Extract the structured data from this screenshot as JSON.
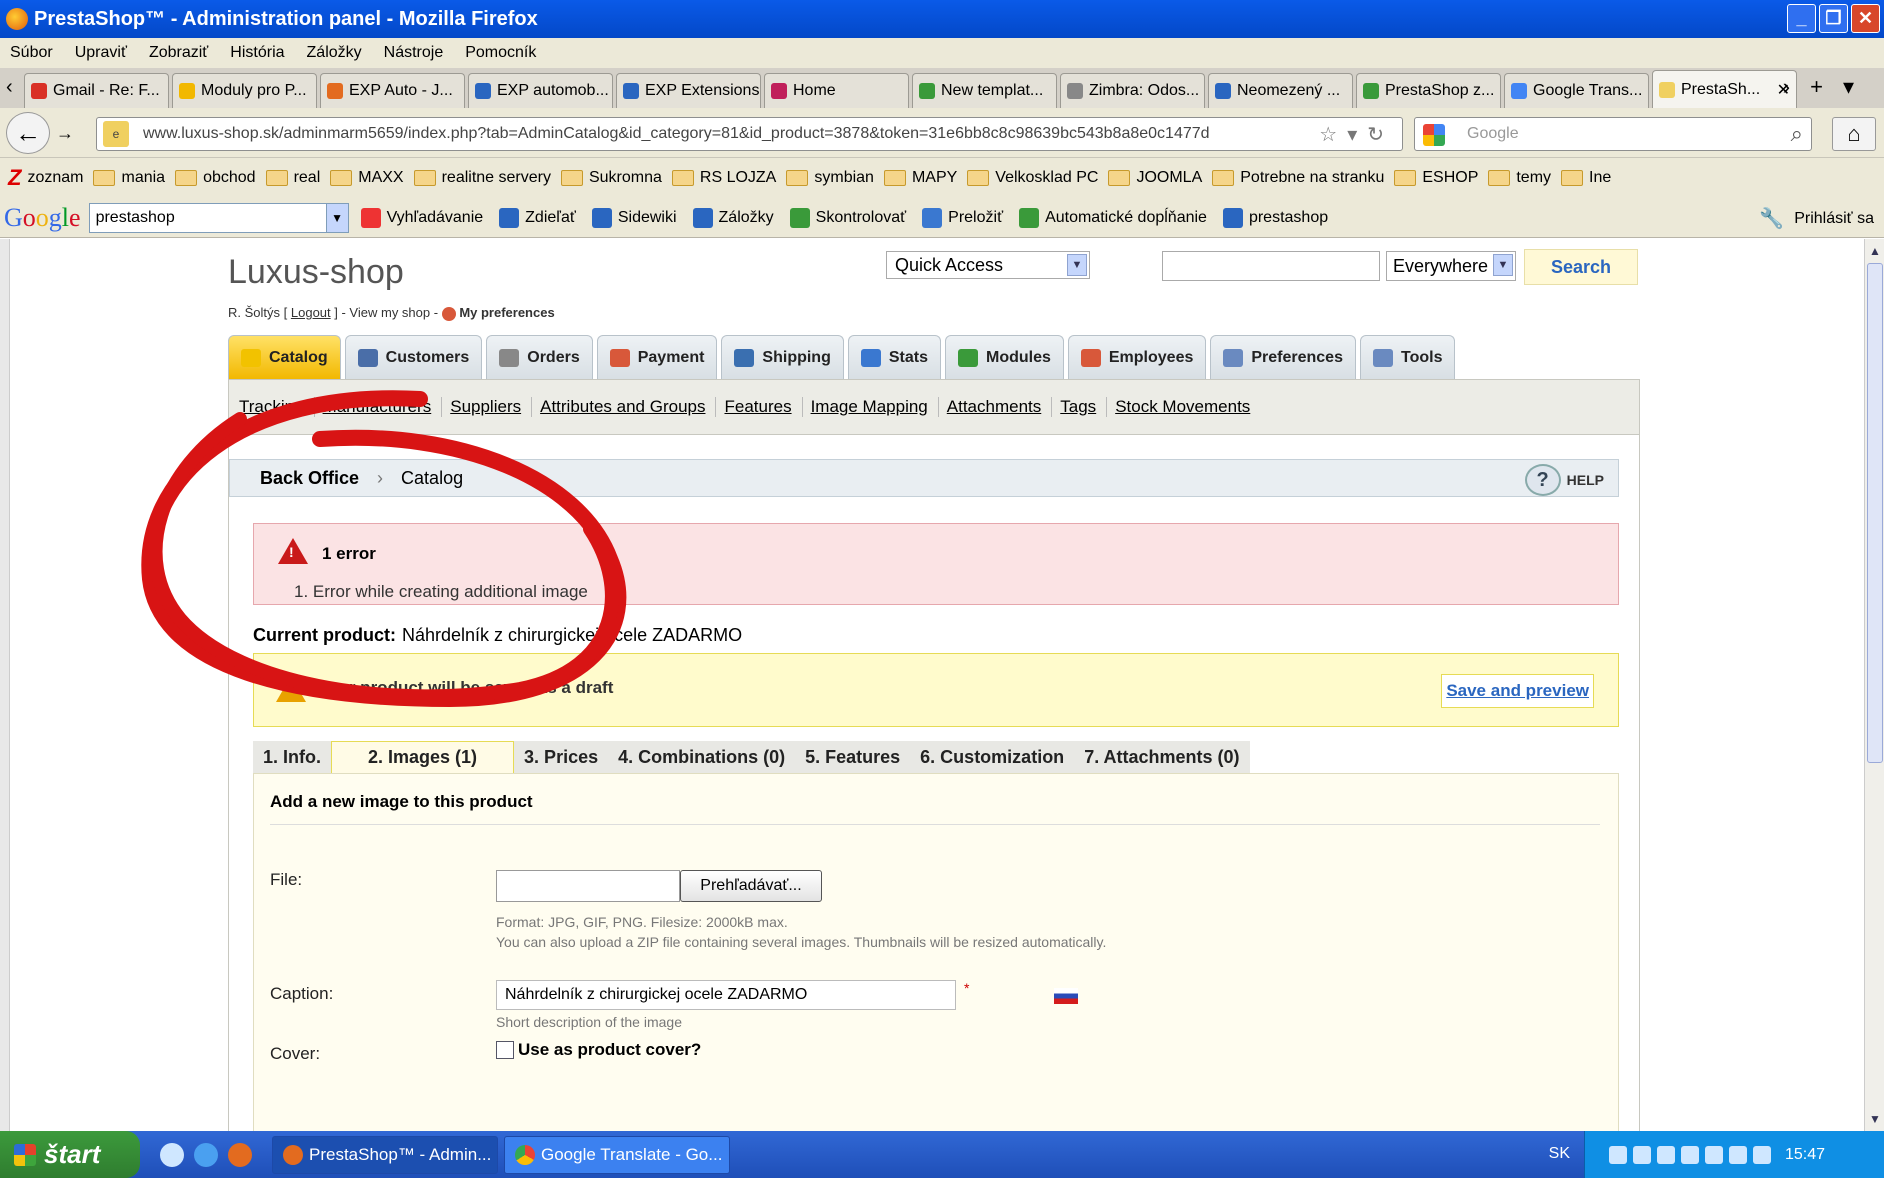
{
  "window": {
    "title": "PrestaShop™ - Administration panel - Mozilla Firefox"
  },
  "menu": [
    "Súbor",
    "Upraviť",
    "Zobraziť",
    "História",
    "Záložky",
    "Nástroje",
    "Pomocník"
  ],
  "tabs": [
    {
      "label": "Gmail - Re: F...",
      "color": "#d93025"
    },
    {
      "label": "Moduly pro P...",
      "color": "#f2b800"
    },
    {
      "label": "EXP Auto - J...",
      "color": "#e36b1f"
    },
    {
      "label": "EXP automob...",
      "color": "#2a66c0"
    },
    {
      "label": "EXP Extensions",
      "color": "#2a66c0"
    },
    {
      "label": "Home",
      "color": "#c01f5a"
    },
    {
      "label": "New templat...",
      "color": "#3a9a3a"
    },
    {
      "label": "Zimbra: Odos...",
      "color": "#888888"
    },
    {
      "label": "Neomezený ...",
      "color": "#2a66c0"
    },
    {
      "label": "PrestaShop z...",
      "color": "#3a9a3a"
    },
    {
      "label": "Google Trans...",
      "color": "#4285f4"
    },
    {
      "label": "PrestaSh...",
      "color": "#f0d060",
      "active": true
    }
  ],
  "nav": {
    "url": "www.luxus-shop.sk/adminmarm5659/index.php?tab=AdminCatalog&id_category=81&id_product=3878&token=31e6bb8c8c98639bc543b8a8e0c1477d",
    "search_placeholder": "Google"
  },
  "bookmarks": [
    "zoznam",
    "mania",
    "obchod",
    "real",
    "MAXX",
    "realitne servery",
    "Sukromna",
    "RS LOJZA",
    "symbian",
    "MAPY",
    "Velkosklad PC",
    "JOOMLA",
    "Potrebne na stranku",
    "ESHOP",
    "temy",
    "Ine"
  ],
  "google_toolbar": {
    "logo": [
      "G",
      "o",
      "o",
      "g",
      "l",
      "e"
    ],
    "query": "prestashop",
    "items": [
      "Vyhľadávanie",
      "Zdieľať",
      "Sidewiki",
      "Záložky",
      "Skontrolovať",
      "Preložiť",
      "Automatické dopĺňanie",
      "prestashop"
    ],
    "signin": "Prihlásiť sa"
  },
  "shop": {
    "name": "Luxus-shop",
    "user": "R. Šoltýs [",
    "logout": "Logout",
    "user_rest": "] - View my shop -",
    "prefs": "My preferences",
    "quick_access": "Quick Access",
    "everywhere": "Everywhere",
    "search_btn": "Search"
  },
  "main_tabs": [
    {
      "label": "Catalog",
      "color": "#f2c200",
      "active": true
    },
    {
      "label": "Customers",
      "color": "#4a6ea8"
    },
    {
      "label": "Orders",
      "color": "#888888"
    },
    {
      "label": "Payment",
      "color": "#d8583a"
    },
    {
      "label": "Shipping",
      "color": "#3a6fb0"
    },
    {
      "label": "Stats",
      "color": "#3a78d0"
    },
    {
      "label": "Modules",
      "color": "#3a9a3a"
    },
    {
      "label": "Employees",
      "color": "#d8583a"
    },
    {
      "label": "Preferences",
      "color": "#6a8ac0"
    },
    {
      "label": "Tools",
      "color": "#6a8ac0"
    }
  ],
  "sub_nav": [
    "Tracking",
    "Manufacturers",
    "Suppliers",
    "Attributes and Groups",
    "Features",
    "Image Mapping",
    "Attachments",
    "Tags",
    "Stock Movements"
  ],
  "breadcrumb": {
    "root": "Back Office",
    "sep": "›",
    "current": "Catalog",
    "help": "HELP"
  },
  "error": {
    "title": "1 error",
    "items": [
      "1.  Error while creating additional image"
    ]
  },
  "current_product": {
    "label": "Current product:",
    "value": "Náhrdelník z chirurgickej ocele ZADARMO"
  },
  "draft": {
    "text": "Your product will be saved as a draft",
    "link": "Save and preview"
  },
  "product_tabs": [
    "1. Info.",
    "2. Images (1)",
    "3. Prices",
    "4. Combinations (0)",
    "5. Features",
    "6. Customization",
    "7. Attachments (0)"
  ],
  "images_form": {
    "heading": "Add a new image to this product",
    "file_label": "File:",
    "browse": "Prehľadávať...",
    "note1": "Format: JPG, GIF, PNG. Filesize: 2000kB max.",
    "note2": "You can also upload a ZIP file containing several images. Thumbnails will be resized automatically.",
    "caption_label": "Caption:",
    "caption_value": "Náhrdelník z chirurgickej ocele ZADARMO",
    "required": "*",
    "caption_note": "Short description of the image",
    "cover_label": "Cover:",
    "cover_checkbox": "Use as product cover?"
  },
  "taskbar": {
    "start": "štart",
    "tasks": [
      {
        "label": "PrestaShop™ - Admin...",
        "active": true
      },
      {
        "label": "Google Translate - Go..."
      }
    ],
    "lang": "SK",
    "time": "15:47"
  }
}
